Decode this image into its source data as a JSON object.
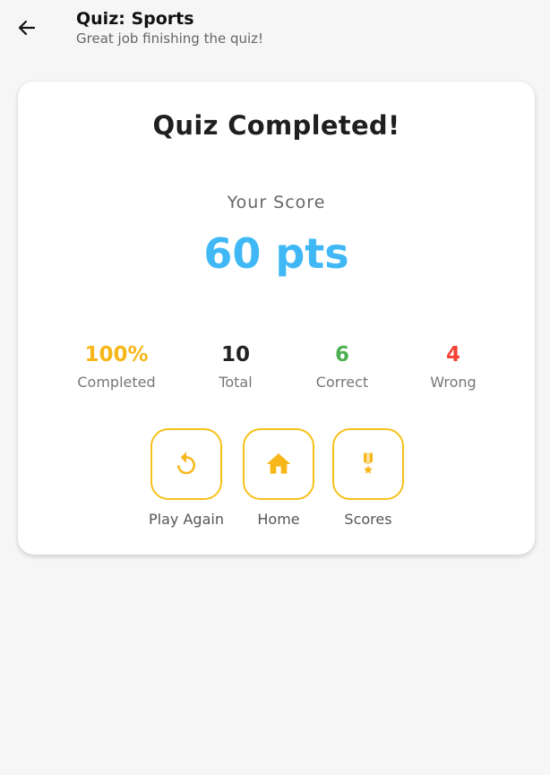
{
  "header": {
    "title": "Quiz: Sports",
    "subtitle": "Great job finishing the quiz!",
    "back_icon": "arrow-left-icon"
  },
  "card": {
    "heading": "Quiz Completed!",
    "score_label": "Your Score",
    "score_value": "60 pts"
  },
  "stats": [
    {
      "value": "100%",
      "label": "Completed",
      "color": "#f7b71a"
    },
    {
      "value": "10",
      "label": "Total",
      "color": "#222222"
    },
    {
      "value": "6",
      "label": "Correct",
      "color": "#4caf50"
    },
    {
      "value": "4",
      "label": "Wrong",
      "color": "#f44336"
    }
  ],
  "actions": [
    {
      "label": "Play Again",
      "icon": "replay-icon"
    },
    {
      "label": "Home",
      "icon": "home-icon"
    },
    {
      "label": "Scores",
      "icon": "medal-icon"
    }
  ],
  "colors": {
    "accent": "#f7c11a",
    "score": "#3fb8f5",
    "background": "#f6f6f6"
  }
}
